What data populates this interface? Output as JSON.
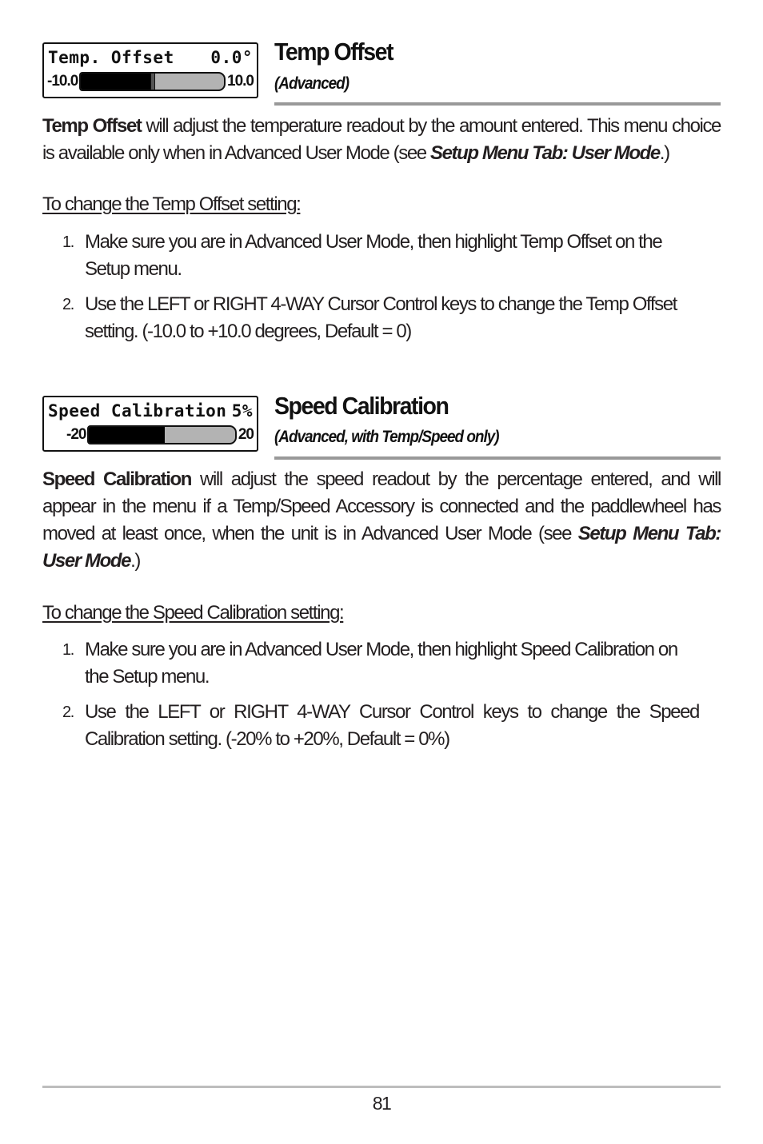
{
  "sections": [
    {
      "widget": {
        "label": "Temp. Offset",
        "value": "0.0°",
        "min_label": "-10.0",
        "max_label": "10.0",
        "fill_fraction": 0.5,
        "has_thumb": true
      },
      "title": "Temp Offset",
      "subtitle": "(Advanced)",
      "description": {
        "bold_lead": "Temp Offset",
        "text": " will adjust the temperature readout by the amount entered. This menu choice is available only when in Advanced User Mode  (see ",
        "ref": "Setup Menu Tab: User Mode",
        "tail": ".)"
      },
      "procedure_title": "To change the Temp Offset setting:",
      "steps": [
        {
          "num": "1.",
          "text": "Make sure you are in Advanced User Mode, then highlight Temp Offset on the Setup menu."
        },
        {
          "num": "2.",
          "text": "Use the LEFT or RIGHT 4-WAY Cursor Control keys to change the Temp Offset setting. (-10.0 to +10.0 degrees, Default = 0)"
        }
      ]
    },
    {
      "widget": {
        "label": "Speed Calibration",
        "value": "5%",
        "min_label": "-20",
        "max_label": "20",
        "fill_fraction": 0.52,
        "has_thumb": false
      },
      "title": "Speed Calibration",
      "subtitle": "(Advanced, with Temp/Speed only)",
      "description": {
        "bold_lead": "Speed Calibration",
        "text": " will adjust the speed readout by the percentage entered, and will appear in the menu if a Temp/Speed Accessory is connected and the paddlewheel has moved at least once, when the unit is in Advanced User Mode (see ",
        "ref": "Setup Menu Tab: User Mode",
        "tail": ".)"
      },
      "procedure_title": "To change the Speed Calibration setting:",
      "steps": [
        {
          "num": "1.",
          "text": "Make sure you are in Advanced User Mode, then highlight Speed Calibration on the Setup menu."
        },
        {
          "num": "2.",
          "text": "Use the LEFT or RIGHT 4-WAY Cursor Control keys to change the Speed Calibration setting. (-20% to +20%, Default = 0%)"
        }
      ]
    }
  ],
  "footer": {
    "page_number": "81"
  }
}
